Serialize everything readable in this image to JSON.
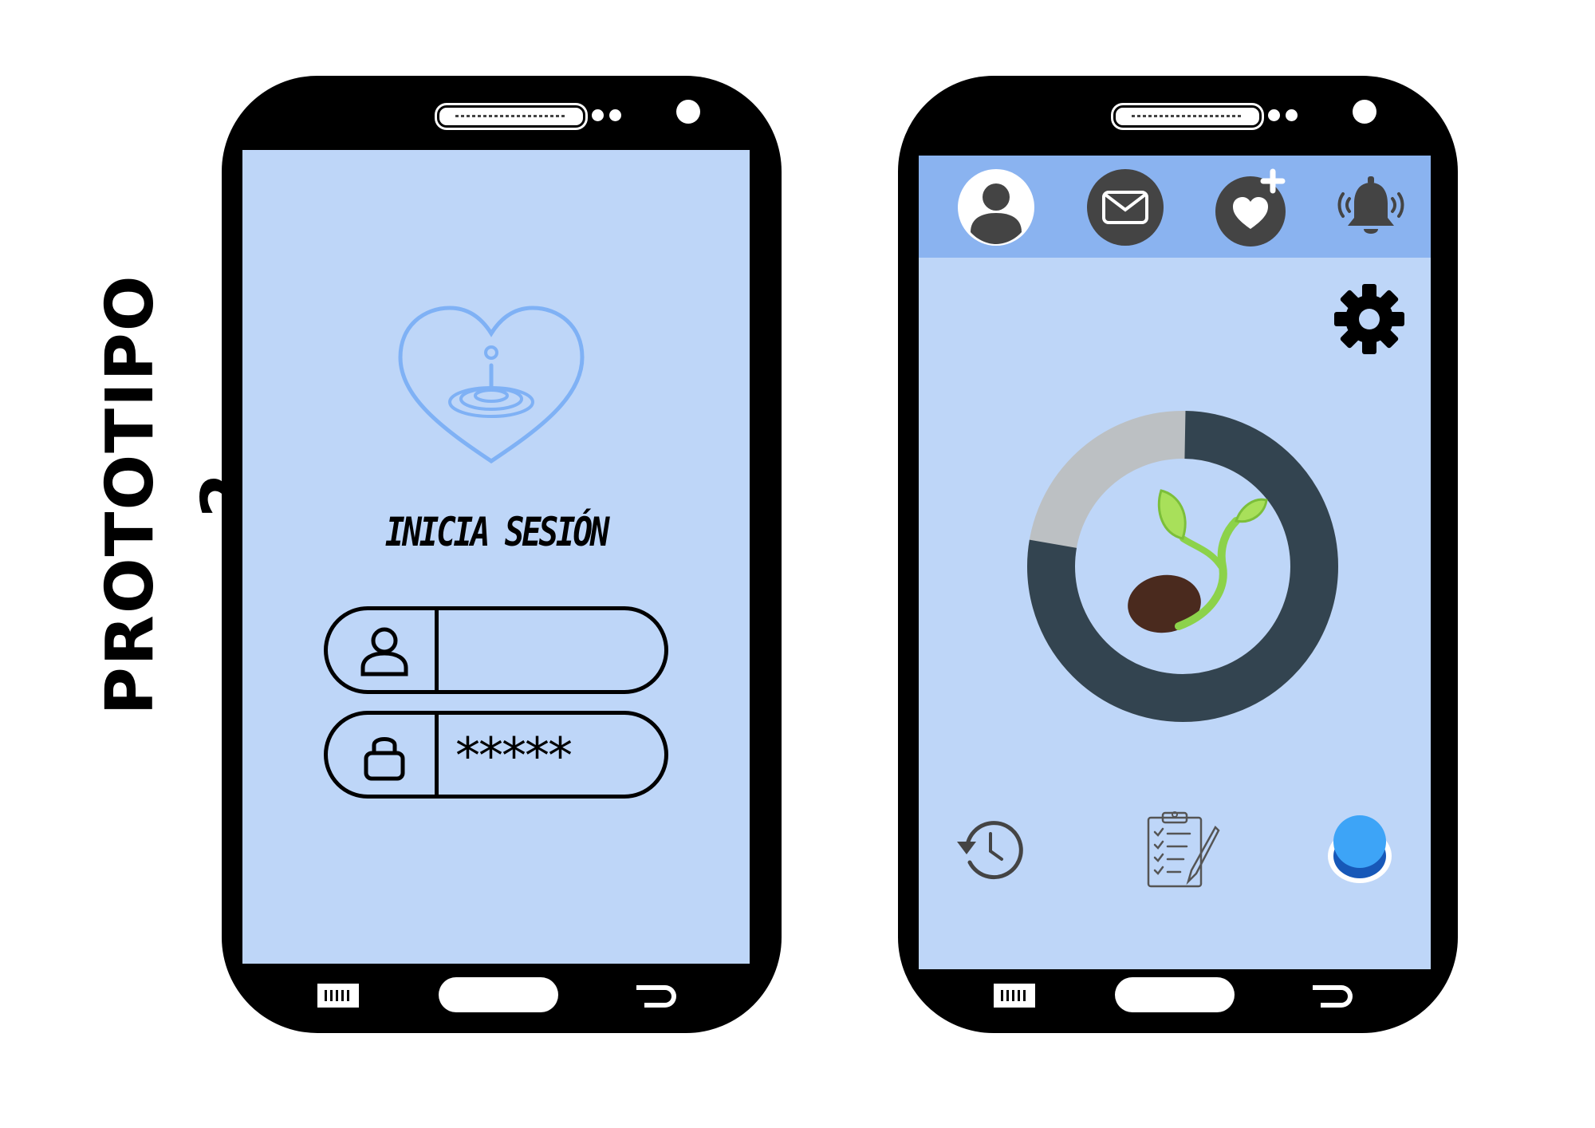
{
  "side_title": "PROTOTIPO 2",
  "login": {
    "title": "INICIA SESIÓN",
    "username_value": "",
    "password_value": "*****",
    "icons": {
      "logo": "heart-water-drop-icon",
      "user": "user-icon",
      "lock": "lock-icon"
    }
  },
  "dashboard": {
    "topbar_icons": [
      "profile-icon",
      "mail-icon",
      "heart-plus-icon",
      "bell-ringing-icon"
    ],
    "settings_icon": "gear-icon",
    "progress": {
      "completed_fraction": 0.78,
      "center_icon": "sprout-icon",
      "colors": {
        "completed": "#334450",
        "remaining": "#bcc0c3"
      }
    },
    "bottom_icons": [
      "history-icon",
      "clipboard-checklist-icon",
      "blue-button-icon"
    ]
  },
  "colors": {
    "screen_bg": "#bed6f8",
    "topbar_bg": "#8ab3f0",
    "logo_stroke": "#7fb1f5",
    "icon_dark": "#444444",
    "accent_blue": "#3da4f7"
  }
}
